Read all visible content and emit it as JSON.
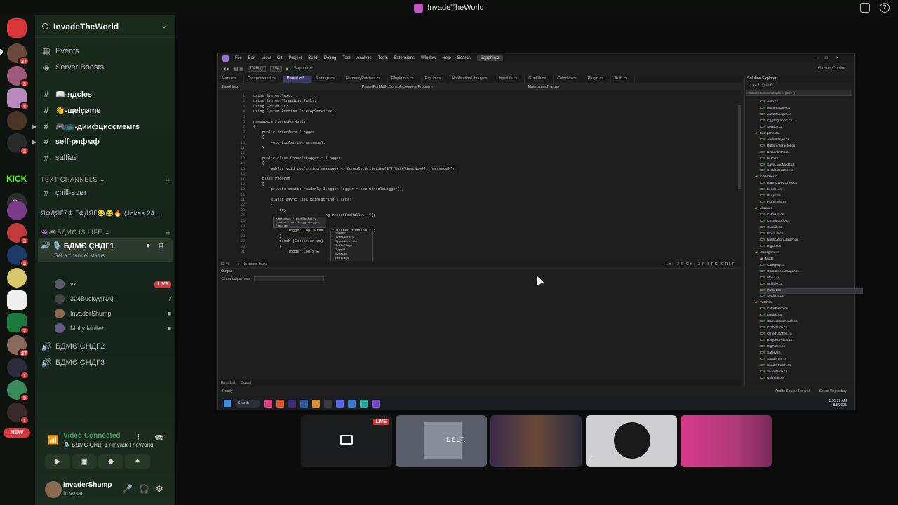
{
  "window": {
    "title": "InvadeTheWorld"
  },
  "rail": {
    "badges": [
      "27",
      "3",
      "4",
      "3",
      "3",
      "2",
      "2",
      "1",
      "27",
      "1",
      "9",
      "1"
    ],
    "kick_label": "KICK",
    "ss_label": "Ss",
    "new_label": "NEW"
  },
  "server": {
    "name": "InvadeTheWorld"
  },
  "sidebar": {
    "events": "Events",
    "boosts": "Server Boosts",
    "channels": [
      "📖-ядcles",
      "👋-щelçøme",
      "🎮📺-диифцисçмeмгs",
      "self-pяфмф",
      "salfias"
    ],
    "text_category": "TEXT CHANNELS",
    "text_channels": [
      "çhill-spør"
    ],
    "collapsed_category": "ЯФДЯГΣФ ГФДЯГ😂😂🔥 (Jokes 24...",
    "voice_category": "👾🎮БДМЄ IS LIFE",
    "active_voice": "🎙️ БДМЄ ÇНДГ1",
    "channel_status": "Set a channel status",
    "voice_users": [
      {
        "name": "vk",
        "tag": "LIVE"
      },
      {
        "name": "324Buckyy[NA]",
        "tag": ""
      },
      {
        "name": "InvaderShump",
        "tag": ""
      },
      {
        "name": "Mully Mullet",
        "tag": ""
      }
    ],
    "other_voice": [
      "БДМЄ ÇНДГ2",
      "БДМЄ ÇНДГ3"
    ]
  },
  "voice_panel": {
    "status": "Video Connected",
    "location": "🎙️ БДМЄ ÇНДГ1 / InvadeTheWorld"
  },
  "user": {
    "name": "InvaderShump",
    "status": "In voice"
  },
  "vs": {
    "menu": [
      "File",
      "Edit",
      "View",
      "Git",
      "Project",
      "Build",
      "Debug",
      "Test",
      "Analyze",
      "Tools",
      "Extensions",
      "Window",
      "Help"
    ],
    "search": "Search",
    "solution": "Sapphirez",
    "config": "Debug",
    "platform": "x64",
    "run": "Sapphirez",
    "copilot": "GitHub Copilot",
    "tabs": [
      "Menu.cs",
      "Overpowered.cs",
      "Preset.cs*",
      "Settings.cs",
      "HarmonyPatches.cs",
      "PluginInfo.cs",
      "RigLib.cs",
      "NotificationLibrary.cs",
      "InputLib.cs",
      "GunLib.cs",
      "ColorLib.cs",
      "Plugin.cs",
      "Auth.cs"
    ],
    "nav": [
      "Sapphirez",
      "PresetForMully.ConsoleLoggers.Program",
      "Main(string[] args)"
    ],
    "code_lines": [
      {
        "n": "1",
        "t": "using System.Text;"
      },
      {
        "n": "2",
        "t": "using System.Threading.Tasks;"
      },
      {
        "n": "3",
        "t": "using System.IO;"
      },
      {
        "n": "4",
        "t": "using System.Runtime.InteropServices;"
      },
      {
        "n": "5",
        "t": ""
      },
      {
        "n": "6",
        "t": "namespace PresetForMully"
      },
      {
        "n": "7",
        "t": "{"
      },
      {
        "n": "8",
        "t": "    public interface ILogger"
      },
      {
        "n": "9",
        "t": "    {"
      },
      {
        "n": "10",
        "t": "        void Log(string message);"
      },
      {
        "n": "11",
        "t": "    }"
      },
      {
        "n": "12",
        "t": ""
      },
      {
        "n": "13",
        "t": "    public class ConsoleLogger : ILogger"
      },
      {
        "n": "14",
        "t": "    {"
      },
      {
        "n": "15",
        "t": "        public void Log(string message) => Console.WriteLine($\"[{DateTime.Now}]: {message}\");"
      },
      {
        "n": "16",
        "t": ""
      },
      {
        "n": "17",
        "t": "    class Program"
      },
      {
        "n": "18",
        "t": "    {"
      },
      {
        "n": "19",
        "t": "        private static readonly ILogger logger = new ConsoleLogger();"
      },
      {
        "n": "20",
        "t": ""
      },
      {
        "n": "21",
        "t": "        static async Task Main(string[] args)"
      },
      {
        "n": "22",
        "t": "        {"
      },
      {
        "n": "23",
        "t": "            try"
      },
      {
        "n": "24",
        "t": "                                 ng PresetForMully...\");"
      },
      {
        "n": "25",
        "t": "                await Task.Delay("
      },
      {
        "n": "26",
        "t": ""
      },
      {
        "n": "27",
        "t": "                logger.Log(\"Pres    finished running.\");"
      },
      {
        "n": "28",
        "t": "            }"
      },
      {
        "n": "29",
        "t": "            catch (Exception ex)"
      },
      {
        "n": "30",
        "t": "            {"
      },
      {
        "n": "31",
        "t": "                logger.Log($\"E         {ex.Message}\");"
      }
    ],
    "tooltip": [
      "namespace PresetForMully",
      "public class ILoggerLogger",
      "Program"
    ],
    "autocomplete": [
      "<Name>",
      "TypeLibrary",
      "TypeLibrarian",
      "TableFlags",
      "TypeOf",
      "typeLib",
      "refflags",
      "type",
      "flags"
    ],
    "zoom": "83 %",
    "no_issues": "No issues found",
    "cursor_pos": {
      "ln": "Ln: 28",
      "ch": "Ch: 37",
      "spc": "SPC",
      "crlf": "CRLF"
    },
    "output_title": "Output",
    "show_output_from": "Show output from:",
    "bottom_tabs": [
      "Error List",
      "Output"
    ],
    "status_ready": "Ready",
    "source_control": "Add to Source Control",
    "select_repo": "Select Repository",
    "sol_title": "Solution Explorer",
    "sol_search": "Search Solution Explorer (Ctrl+;)",
    "tree": [
      {
        "k": "cs",
        "d": 1,
        "name": "Auth.cs"
      },
      {
        "k": "cs",
        "d": 1,
        "name": "Authenticate.cs"
      },
      {
        "k": "cs",
        "d": 1,
        "name": "AuthManager.cs"
      },
      {
        "k": "cs",
        "d": 1,
        "name": "Cryptographic.cs"
      },
      {
        "k": "cs",
        "d": 1,
        "name": "Service.cs"
      },
      {
        "k": "fd",
        "d": 0,
        "name": "Components"
      },
      {
        "k": "cs",
        "d": 1,
        "name": "AudioPlayer.cs"
      },
      {
        "k": "cs",
        "d": 1,
        "name": "ButtonInteractor.cs"
      },
      {
        "k": "cs",
        "d": 1,
        "name": "DiscordRPC.cs"
      },
      {
        "k": "cs",
        "d": 1,
        "name": "HUD.cs"
      },
      {
        "k": "cs",
        "d": 1,
        "name": "SaveLoadMods.cs"
      },
      {
        "k": "cs",
        "d": 1,
        "name": "ScrollInteractor.cs"
      },
      {
        "k": "fd",
        "d": 0,
        "name": "Initialization"
      },
      {
        "k": "cs",
        "d": 1,
        "name": "HarmonyPatches.cs"
      },
      {
        "k": "cs",
        "d": 1,
        "name": "Loader.cs"
      },
      {
        "k": "cs",
        "d": 1,
        "name": "Plugin.cs"
      },
      {
        "k": "cs",
        "d": 1,
        "name": "PluginInfo.cs"
      },
      {
        "k": "fd",
        "d": 0,
        "name": "Libraries"
      },
      {
        "k": "cs",
        "d": 1,
        "name": "ColorLib.cs"
      },
      {
        "k": "cs",
        "d": 1,
        "name": "CosmeticLib.cs"
      },
      {
        "k": "cs",
        "d": 1,
        "name": "GunLib.cs"
      },
      {
        "k": "cs",
        "d": 1,
        "name": "InputLib.cs"
      },
      {
        "k": "cs",
        "d": 1,
        "name": "NotificationLibrary.cs"
      },
      {
        "k": "cs",
        "d": 1,
        "name": "RigLib.cs"
      },
      {
        "k": "fd",
        "d": 0,
        "name": "Management"
      },
      {
        "k": "fd",
        "d": 1,
        "name": "Mods"
      },
      {
        "k": "cs",
        "d": 1,
        "name": "Category.cs"
      },
      {
        "k": "cs",
        "d": 1,
        "name": "CoroutineManager.cs"
      },
      {
        "k": "cs",
        "d": 1,
        "name": "Menu.cs"
      },
      {
        "k": "cs",
        "d": 1,
        "name": "Module.cs"
      },
      {
        "k": "cs",
        "d": 1,
        "name": "Preset.cs",
        "sel": true
      },
      {
        "k": "cs",
        "d": 1,
        "name": "Settings.cs"
      },
      {
        "k": "fd",
        "d": 0,
        "name": "Patches"
      },
      {
        "k": "cs",
        "d": 1,
        "name": "ColorPatch.cs"
      },
      {
        "k": "cs",
        "d": 1,
        "name": "Enable.cs"
      },
      {
        "k": "cs",
        "d": 1,
        "name": "GamemodePatch.cs"
      },
      {
        "k": "cs",
        "d": 1,
        "name": "GrabPatch.cs"
      },
      {
        "k": "cs",
        "d": 1,
        "name": "OtherPatches.cs"
      },
      {
        "k": "cs",
        "d": 1,
        "name": "RequestPatch.cs"
      },
      {
        "k": "cs",
        "d": 1,
        "name": "RigPatch.cs"
      },
      {
        "k": "cs",
        "d": 1,
        "name": "Safety.cs"
      },
      {
        "k": "cs",
        "d": 1,
        "name": "ShaderFix.cs"
      },
      {
        "k": "cs",
        "d": 1,
        "name": "ShaderPatch.cs"
      },
      {
        "k": "cs",
        "d": 1,
        "name": "SlidePatch.cs"
      },
      {
        "k": "cs",
        "d": 1,
        "name": "Unlimiter.cs"
      }
    ],
    "taskbar_search": "Search",
    "clock_time": "5:51:20 AM",
    "clock_date": "8/5/2025"
  },
  "tiles": {
    "live_tag": "LIVE",
    "tile2_text": "DELT."
  }
}
